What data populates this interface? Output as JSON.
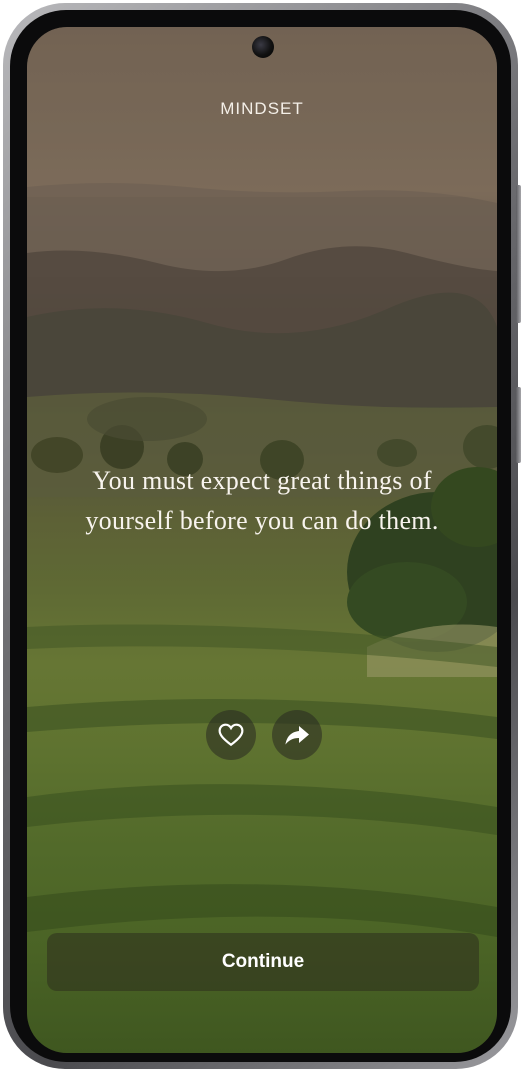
{
  "app": {
    "brand": "MINDSET"
  },
  "quote": {
    "text": "You must expect great things of yourself before you can do them."
  },
  "actions": {
    "like_icon": "heart-outline-icon",
    "share_icon": "share-arrow-icon"
  },
  "footer": {
    "continue_label": "Continue"
  },
  "colors": {
    "text": "#f8f4ee",
    "button_overlay": "rgba(45,45,30,0.55)"
  }
}
